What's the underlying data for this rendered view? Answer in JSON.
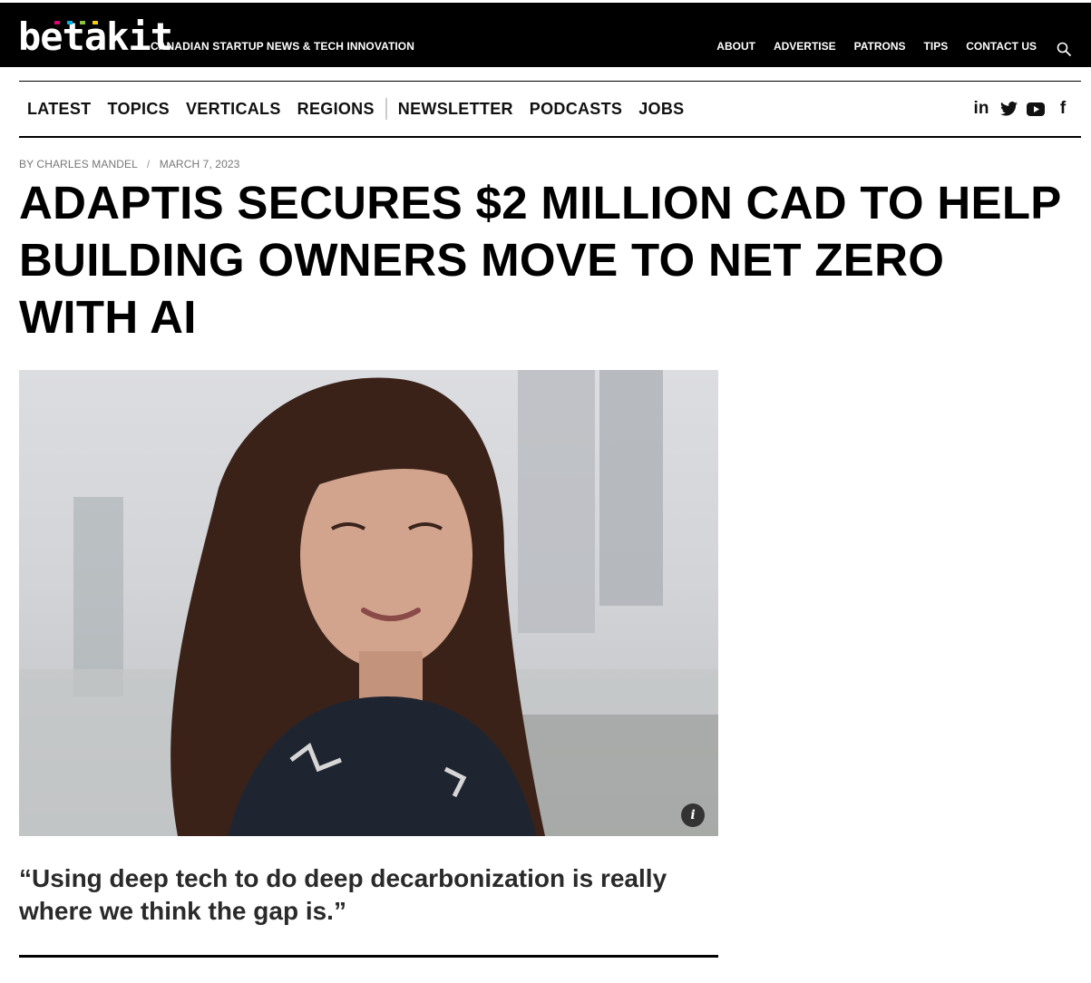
{
  "site": {
    "logo_text": "betakit",
    "tagline": "CANADIAN STARTUP NEWS & TECH INNOVATION",
    "logo_accent_colors": [
      "#e0007a",
      "#00b4e6",
      "#8cc63f",
      "#ffcc00"
    ]
  },
  "top_nav": [
    {
      "label": "ABOUT"
    },
    {
      "label": "ADVERTISE"
    },
    {
      "label": "PATRONS"
    },
    {
      "label": "TIPS"
    },
    {
      "label": "CONTACT US"
    }
  ],
  "main_nav": {
    "left": [
      {
        "label": "LATEST"
      },
      {
        "label": "TOPICS"
      },
      {
        "label": "VERTICALS"
      },
      {
        "label": "REGIONS"
      }
    ],
    "right": [
      {
        "label": "NEWSLETTER"
      },
      {
        "label": "PODCASTS"
      },
      {
        "label": "JOBS"
      }
    ]
  },
  "social": [
    {
      "icon": "linkedin-icon",
      "glyph": "in"
    },
    {
      "icon": "twitter-icon",
      "glyph": "🐦"
    },
    {
      "icon": "youtube-icon",
      "glyph": "▶"
    },
    {
      "icon": "facebook-icon",
      "glyph": "f"
    }
  ],
  "article": {
    "author": "BY CHARLES MANDEL",
    "separator": "/",
    "date": "MARCH 7, 2023",
    "headline": "ADAPTIS SECURES $2 MILLION CAD TO HELP BUILDING OWNERS MOVE TO NET ZERO WITH AI",
    "pull_quote": "“Using deep tech to do deep decarbonization is really where we think the gap is.”",
    "image_info_glyph": "i"
  }
}
